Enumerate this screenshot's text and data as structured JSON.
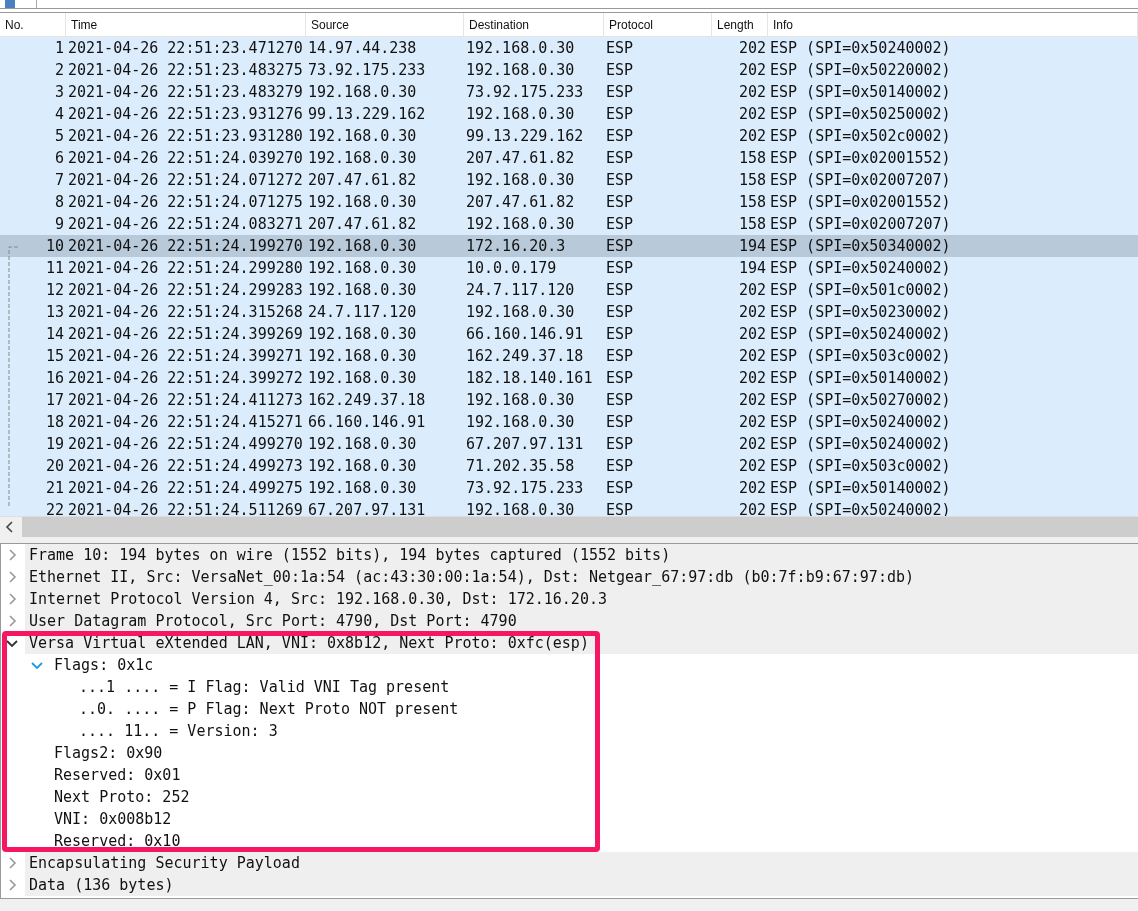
{
  "columns": [
    "No.",
    "Time",
    "Source",
    "Destination",
    "Protocol",
    "Length",
    "Info"
  ],
  "rows": [
    {
      "cells": [
        "1",
        "2021-04-26 22:51:23.471270",
        "14.97.44.238",
        "192.168.0.30",
        "ESP",
        "202",
        "ESP (SPI=0x50240002)"
      ],
      "selected": false
    },
    {
      "cells": [
        "2",
        "2021-04-26 22:51:23.483275",
        "73.92.175.233",
        "192.168.0.30",
        "ESP",
        "202",
        "ESP (SPI=0x50220002)"
      ],
      "selected": false
    },
    {
      "cells": [
        "3",
        "2021-04-26 22:51:23.483279",
        "192.168.0.30",
        "73.92.175.233",
        "ESP",
        "202",
        "ESP (SPI=0x50140002)"
      ],
      "selected": false
    },
    {
      "cells": [
        "4",
        "2021-04-26 22:51:23.931276",
        "99.13.229.162",
        "192.168.0.30",
        "ESP",
        "202",
        "ESP (SPI=0x50250002)"
      ],
      "selected": false
    },
    {
      "cells": [
        "5",
        "2021-04-26 22:51:23.931280",
        "192.168.0.30",
        "99.13.229.162",
        "ESP",
        "202",
        "ESP (SPI=0x502c0002)"
      ],
      "selected": false
    },
    {
      "cells": [
        "6",
        "2021-04-26 22:51:24.039270",
        "192.168.0.30",
        "207.47.61.82",
        "ESP",
        "158",
        "ESP (SPI=0x02001552)"
      ],
      "selected": false
    },
    {
      "cells": [
        "7",
        "2021-04-26 22:51:24.071272",
        "207.47.61.82",
        "192.168.0.30",
        "ESP",
        "158",
        "ESP (SPI=0x02007207)"
      ],
      "selected": false
    },
    {
      "cells": [
        "8",
        "2021-04-26 22:51:24.071275",
        "192.168.0.30",
        "207.47.61.82",
        "ESP",
        "158",
        "ESP (SPI=0x02001552)"
      ],
      "selected": false
    },
    {
      "cells": [
        "9",
        "2021-04-26 22:51:24.083271",
        "207.47.61.82",
        "192.168.0.30",
        "ESP",
        "158",
        "ESP (SPI=0x02007207)"
      ],
      "selected": false
    },
    {
      "cells": [
        "10",
        "2021-04-26 22:51:24.199270",
        "192.168.0.30",
        "172.16.20.3",
        "ESP",
        "194",
        "ESP (SPI=0x50340002)"
      ],
      "selected": true
    },
    {
      "cells": [
        "11",
        "2021-04-26 22:51:24.299280",
        "192.168.0.30",
        "10.0.0.179",
        "ESP",
        "194",
        "ESP (SPI=0x50240002)"
      ],
      "selected": false
    },
    {
      "cells": [
        "12",
        "2021-04-26 22:51:24.299283",
        "192.168.0.30",
        "24.7.117.120",
        "ESP",
        "202",
        "ESP (SPI=0x501c0002)"
      ],
      "selected": false
    },
    {
      "cells": [
        "13",
        "2021-04-26 22:51:24.315268",
        "24.7.117.120",
        "192.168.0.30",
        "ESP",
        "202",
        "ESP (SPI=0x50230002)"
      ],
      "selected": false
    },
    {
      "cells": [
        "14",
        "2021-04-26 22:51:24.399269",
        "192.168.0.30",
        "66.160.146.91",
        "ESP",
        "202",
        "ESP (SPI=0x50240002)"
      ],
      "selected": false
    },
    {
      "cells": [
        "15",
        "2021-04-26 22:51:24.399271",
        "192.168.0.30",
        "162.249.37.18",
        "ESP",
        "202",
        "ESP (SPI=0x503c0002)"
      ],
      "selected": false
    },
    {
      "cells": [
        "16",
        "2021-04-26 22:51:24.399272",
        "192.168.0.30",
        "182.18.140.161",
        "ESP",
        "202",
        "ESP (SPI=0x50140002)"
      ],
      "selected": false
    },
    {
      "cells": [
        "17",
        "2021-04-26 22:51:24.411273",
        "162.249.37.18",
        "192.168.0.30",
        "ESP",
        "202",
        "ESP (SPI=0x50270002)"
      ],
      "selected": false
    },
    {
      "cells": [
        "18",
        "2021-04-26 22:51:24.415271",
        "66.160.146.91",
        "192.168.0.30",
        "ESP",
        "202",
        "ESP (SPI=0x50240002)"
      ],
      "selected": false
    },
    {
      "cells": [
        "19",
        "2021-04-26 22:51:24.499270",
        "192.168.0.30",
        "67.207.97.131",
        "ESP",
        "202",
        "ESP (SPI=0x50240002)"
      ],
      "selected": false
    },
    {
      "cells": [
        "20",
        "2021-04-26 22:51:24.499273",
        "192.168.0.30",
        "71.202.35.58",
        "ESP",
        "202",
        "ESP (SPI=0x503c0002)"
      ],
      "selected": false
    },
    {
      "cells": [
        "21",
        "2021-04-26 22:51:24.499275",
        "192.168.0.30",
        "73.92.175.233",
        "ESP",
        "202",
        "ESP (SPI=0x50140002)"
      ],
      "selected": false
    },
    {
      "cells": [
        "22",
        "2021-04-26 22:51:24.511269",
        "67.207.97.131",
        "192.168.0.30",
        "ESP",
        "202",
        "ESP (SPI=0x50240002)"
      ],
      "selected": false
    }
  ],
  "details": [
    {
      "label": "Frame 10: 194 bytes on wire (1552 bits), 194 bytes captured (1552 bits)",
      "expanded": false
    },
    {
      "label": "Ethernet II, Src: VersaNet_00:1a:54 (ac:43:30:00:1a:54), Dst: Netgear_67:97:db (b0:7f:b9:67:97:db)",
      "expanded": false
    },
    {
      "label": "Internet Protocol Version 4, Src: 192.168.0.30, Dst: 172.16.20.3",
      "expanded": false
    },
    {
      "label": "User Datagram Protocol, Src Port: 4790, Dst Port: 4790",
      "expanded": false
    },
    {
      "label": "Versa Virtual eXtended LAN, VNI: 0x8b12, Next Proto: 0xfc(esp)",
      "expanded": true,
      "children": [
        {
          "label": "Flags: 0x1c",
          "expanded": true,
          "children": [
            {
              "label": "...1 .... = I Flag: Valid VNI Tag present"
            },
            {
              "label": "..0. .... = P Flag: Next Proto NOT present"
            },
            {
              "label": ".... 11.. = Version: 3"
            }
          ]
        },
        {
          "label": "Flags2: 0x90"
        },
        {
          "label": "Reserved: 0x01"
        },
        {
          "label": "Next Proto: 252"
        },
        {
          "label": "VNI: 0x008b12"
        },
        {
          "label": "Reserved: 0x10"
        }
      ]
    },
    {
      "label": "Encapsulating Security Payload",
      "expanded": false
    },
    {
      "label": "Data (136 bytes)",
      "expanded": false
    }
  ]
}
